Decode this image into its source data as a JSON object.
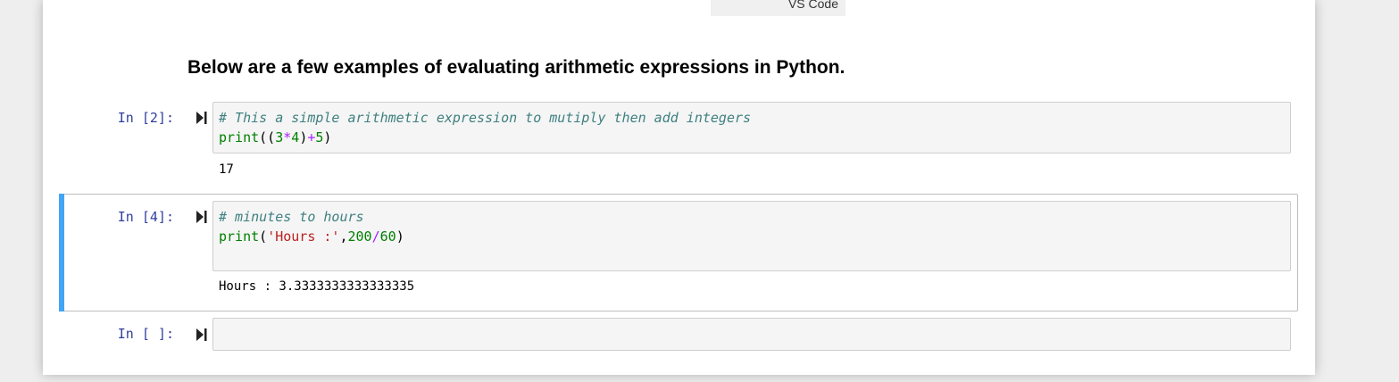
{
  "top_tab": {
    "label": "VS Code"
  },
  "markdown": {
    "heading": "Below are a few examples of evaluating arithmetic expressions in Python."
  },
  "cells": [
    {
      "prompt": "In [2]:",
      "line1": "# This a simple arithmetic expression to mutiply then add integers",
      "line2_tokens": [
        "print",
        "((",
        "3",
        "*",
        "4",
        ")",
        "+",
        "5",
        ")"
      ],
      "output": "17"
    },
    {
      "prompt": "In [4]:",
      "line1": "# minutes to hours",
      "line2_tokens": [
        "print",
        "(",
        "'Hours :'",
        ",",
        "200",
        "/",
        "60",
        ")"
      ],
      "output": "Hours : 3.3333333333333335"
    },
    {
      "prompt": "In [ ]:"
    }
  ],
  "colors": {
    "prompt": "#303f9f",
    "selection_bar": "#42a5f5",
    "comment": "#408080",
    "builtin": "#008000",
    "operator": "#aa22ff",
    "string": "#ba2121"
  }
}
